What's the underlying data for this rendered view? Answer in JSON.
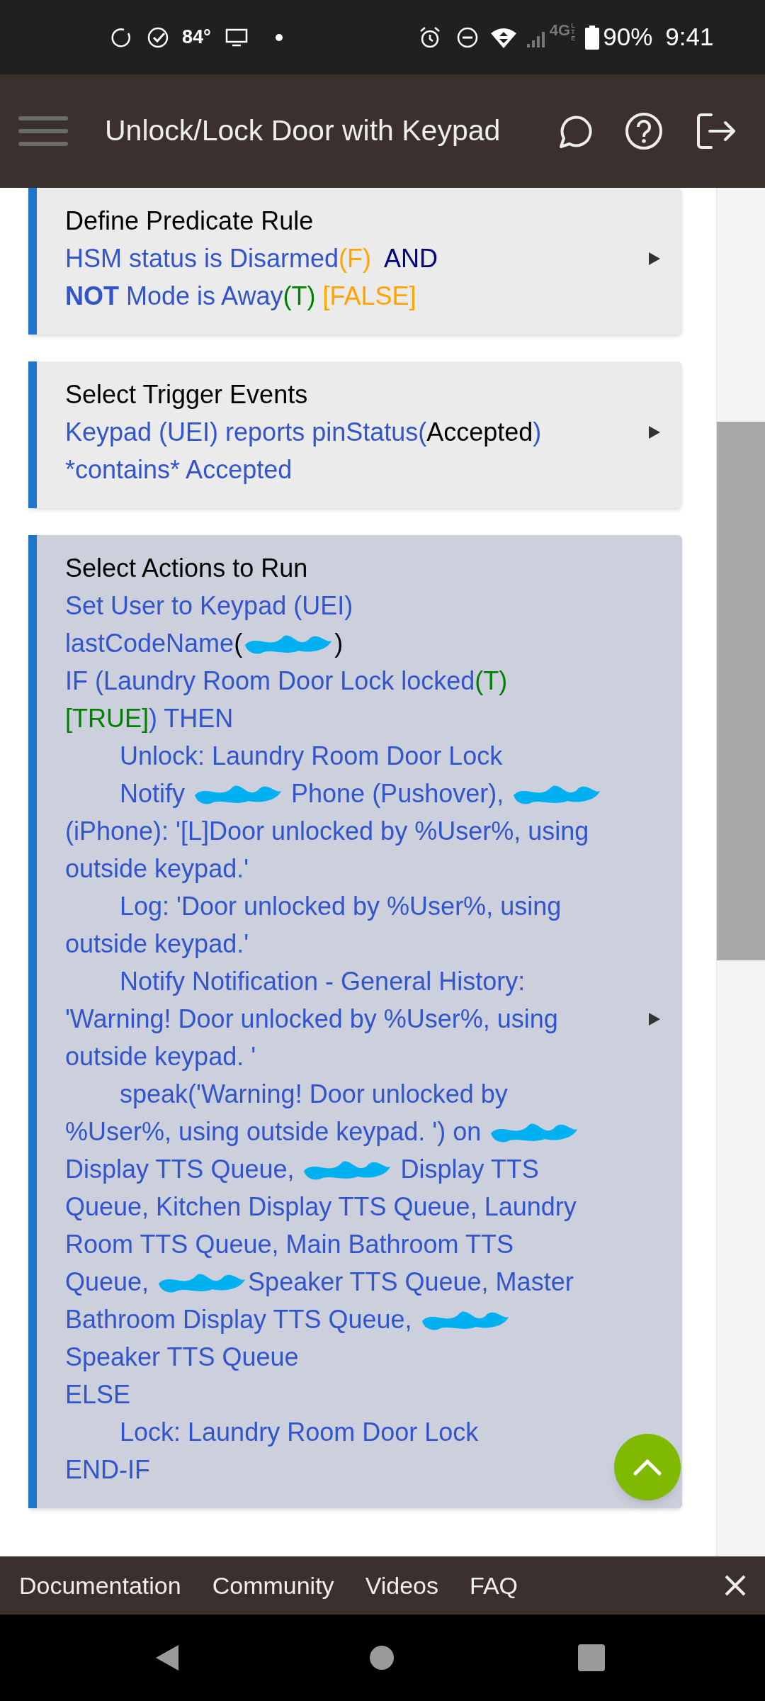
{
  "status_bar": {
    "temperature": "84°",
    "network": "4G",
    "network_sub": "LTE",
    "battery": "90%",
    "time": "9:41"
  },
  "header": {
    "title": "Unlock/Lock Door with Keypad"
  },
  "cards": [
    {
      "title": "Define Predicate Rule",
      "highlighted": false,
      "lines": [
        {
          "indent": false,
          "segments": [
            {
              "kind": "text",
              "text": "HSM status is Disarmed",
              "color": "#3355cc",
              "bold": false
            },
            {
              "kind": "text",
              "text": "(F)",
              "color": "#ffa500",
              "bold": false
            },
            {
              "kind": "text",
              "text": "  AND",
              "color": "#000080",
              "bold": false
            }
          ]
        },
        {
          "indent": false,
          "segments": [
            {
              "kind": "text",
              "text": "NOT",
              "color": "#3355cc",
              "bold": true
            },
            {
              "kind": "text",
              "text": " Mode is Away",
              "color": "#3355cc",
              "bold": false
            },
            {
              "kind": "text",
              "text": "(T)",
              "color": "#008000",
              "bold": false
            },
            {
              "kind": "text",
              "text": " [FALSE]",
              "color": "#ffa500",
              "bold": false
            }
          ]
        }
      ]
    },
    {
      "title": "Select Trigger Events",
      "highlighted": false,
      "lines": [
        {
          "indent": false,
          "segments": [
            {
              "kind": "text",
              "text": "Keypad (UEI) reports pinStatus(",
              "color": "#3355cc",
              "bold": false
            },
            {
              "kind": "text",
              "text": "Accepted",
              "color": "#000000",
              "bold": false
            },
            {
              "kind": "text",
              "text": ")",
              "color": "#3355cc",
              "bold": false
            }
          ]
        },
        {
          "indent": false,
          "segments": [
            {
              "kind": "text",
              "text": "*contains* Accepted",
              "color": "#3355cc",
              "bold": false
            }
          ]
        }
      ]
    },
    {
      "title": "Select Actions to Run",
      "highlighted": true,
      "lines": [
        {
          "indent": false,
          "segments": [
            {
              "kind": "text",
              "text": "Set User to Keypad (UEI)",
              "color": "#3355cc",
              "bold": false
            }
          ]
        },
        {
          "indent": false,
          "segments": [
            {
              "kind": "text",
              "text": "lastCodeName",
              "color": "#3355cc",
              "bold": false
            },
            {
              "kind": "text",
              "text": "(",
              "color": "#000000",
              "bold": false
            },
            {
              "kind": "redaction"
            },
            {
              "kind": "text",
              "text": ")",
              "color": "#000000",
              "bold": false
            }
          ]
        },
        {
          "indent": false,
          "segments": [
            {
              "kind": "text",
              "text": "IF (Laundry Room Door Lock locked",
              "color": "#3355cc",
              "bold": false
            },
            {
              "kind": "text",
              "text": "(T)",
              "color": "#008000",
              "bold": false
            }
          ]
        },
        {
          "indent": false,
          "segments": [
            {
              "kind": "text",
              "text": "[TRUE]",
              "color": "#008000",
              "bold": false
            },
            {
              "kind": "text",
              "text": ") THEN",
              "color": "#3355cc",
              "bold": false
            }
          ]
        },
        {
          "indent": true,
          "segments": [
            {
              "kind": "text",
              "text": "Unlock: Laundry Room Door Lock",
              "color": "#3355cc",
              "bold": false
            }
          ]
        },
        {
          "indent": true,
          "segments": [
            {
              "kind": "text",
              "text": "Notify ",
              "color": "#3355cc",
              "bold": false
            },
            {
              "kind": "redaction"
            },
            {
              "kind": "text",
              "text": " Phone (Pushover), ",
              "color": "#3355cc",
              "bold": false
            },
            {
              "kind": "redaction"
            }
          ]
        },
        {
          "indent": false,
          "segments": [
            {
              "kind": "text",
              "text": "(iPhone): '[L]Door unlocked by %User%, using",
              "color": "#3355cc",
              "bold": false
            }
          ]
        },
        {
          "indent": false,
          "segments": [
            {
              "kind": "text",
              "text": "outside keypad.'",
              "color": "#3355cc",
              "bold": false
            }
          ]
        },
        {
          "indent": true,
          "segments": [
            {
              "kind": "text",
              "text": "Log: 'Door unlocked by %User%, using",
              "color": "#3355cc",
              "bold": false
            }
          ]
        },
        {
          "indent": false,
          "segments": [
            {
              "kind": "text",
              "text": "outside keypad.'",
              "color": "#3355cc",
              "bold": false
            }
          ]
        },
        {
          "indent": true,
          "segments": [
            {
              "kind": "text",
              "text": "Notify Notification - General History:",
              "color": "#3355cc",
              "bold": false
            }
          ]
        },
        {
          "indent": false,
          "segments": [
            {
              "kind": "text",
              "text": "'Warning! Door unlocked by %User%, using",
              "color": "#3355cc",
              "bold": false
            }
          ]
        },
        {
          "indent": false,
          "segments": [
            {
              "kind": "text",
              "text": "outside keypad. '",
              "color": "#3355cc",
              "bold": false
            }
          ]
        },
        {
          "indent": true,
          "segments": [
            {
              "kind": "text",
              "text": "speak('Warning! Door unlocked by",
              "color": "#3355cc",
              "bold": false
            }
          ]
        },
        {
          "indent": false,
          "segments": [
            {
              "kind": "text",
              "text": "%User%, using outside keypad. ') on ",
              "color": "#3355cc",
              "bold": false
            },
            {
              "kind": "redaction"
            }
          ]
        },
        {
          "indent": false,
          "segments": [
            {
              "kind": "text",
              "text": "Display TTS Queue, ",
              "color": "#3355cc",
              "bold": false
            },
            {
              "kind": "redaction"
            },
            {
              "kind": "text",
              "text": " Display TTS",
              "color": "#3355cc",
              "bold": false
            }
          ]
        },
        {
          "indent": false,
          "segments": [
            {
              "kind": "text",
              "text": "Queue, Kitchen Display TTS Queue, Laundry",
              "color": "#3355cc",
              "bold": false
            }
          ]
        },
        {
          "indent": false,
          "segments": [
            {
              "kind": "text",
              "text": "Room TTS Queue, Main Bathroom TTS",
              "color": "#3355cc",
              "bold": false
            }
          ]
        },
        {
          "indent": false,
          "segments": [
            {
              "kind": "text",
              "text": "Queue, ",
              "color": "#3355cc",
              "bold": false
            },
            {
              "kind": "redaction"
            },
            {
              "kind": "text",
              "text": "Speaker TTS Queue, Master",
              "color": "#3355cc",
              "bold": false
            }
          ]
        },
        {
          "indent": false,
          "segments": [
            {
              "kind": "text",
              "text": "Bathroom Display TTS Queue, ",
              "color": "#3355cc",
              "bold": false
            },
            {
              "kind": "redaction"
            }
          ]
        },
        {
          "indent": false,
          "segments": [
            {
              "kind": "text",
              "text": "Speaker TTS Queue",
              "color": "#3355cc",
              "bold": false
            }
          ]
        },
        {
          "indent": false,
          "segments": [
            {
              "kind": "text",
              "text": "ELSE",
              "color": "#3355cc",
              "bold": false
            }
          ]
        },
        {
          "indent": true,
          "segments": [
            {
              "kind": "text",
              "text": "Lock: Laundry Room Door Lock",
              "color": "#3355cc",
              "bold": false
            }
          ]
        },
        {
          "indent": false,
          "segments": [
            {
              "kind": "text",
              "text": "END-IF",
              "color": "#3355cc",
              "bold": false
            }
          ]
        }
      ]
    }
  ],
  "footer_links": [
    "Documentation",
    "Community",
    "Videos",
    "FAQ"
  ]
}
